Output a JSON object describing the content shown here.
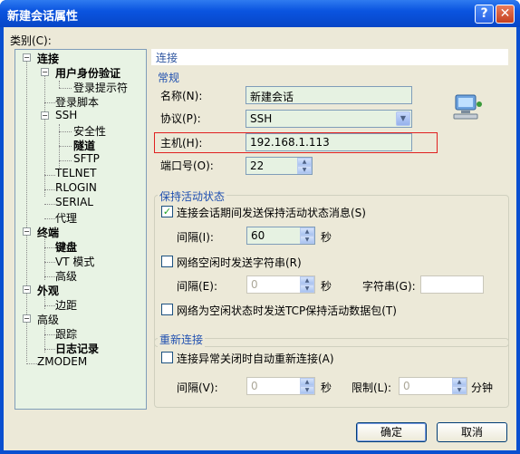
{
  "window": {
    "title": "新建会话属性",
    "help_glyph": "?",
    "close_glyph": "✕"
  },
  "category_label": "类别(C):",
  "tree": {
    "connection": "连接",
    "auth": "用户身份验证",
    "login_prompt": "登录提示符",
    "login_script": "登录脚本",
    "ssh": "SSH",
    "security": "安全性",
    "tunnel": "隧道",
    "sftp": "SFTP",
    "telnet": "TELNET",
    "rlogin": "RLOGIN",
    "serial": "SERIAL",
    "proxy": "代理",
    "terminal": "终端",
    "keyboard": "键盘",
    "vt_mode": "VT 模式",
    "advanced1": "高级",
    "appearance": "外观",
    "margin": "边距",
    "advanced2": "高级",
    "trace": "跟踪",
    "log": "日志记录",
    "zmodem": "ZMODEM"
  },
  "panel_title": "连接",
  "general": {
    "title": "常规",
    "name_label": "名称(N):",
    "name_value": "新建会话",
    "protocol_label": "协议(P):",
    "protocol_value": "SSH",
    "host_label": "主机(H):",
    "host_value": "192.168.1.113",
    "port_label": "端口号(O):",
    "port_value": "22"
  },
  "keepalive": {
    "title": "保持活动状态",
    "send_msg_label": "连接会话期间发送保持活动状态消息(S)",
    "send_msg_checked": true,
    "interval_label": "间隔(I):",
    "interval_value": "60",
    "sec": "秒",
    "send_str_label": "网络空闲时发送字符串(R)",
    "send_str_checked": false,
    "interval2_label": "间隔(E):",
    "interval2_value": "0",
    "sec2": "秒",
    "string_label": "字符串(G):",
    "tcp_label": "网络为空闲状态时发送TCP保持活动数据包(T)",
    "tcp_checked": false
  },
  "reconnect": {
    "title": "重新连接",
    "auto_label": "连接异常关闭时自动重新连接(A)",
    "auto_checked": false,
    "interval_label": "间隔(V):",
    "interval_value": "0",
    "sec": "秒",
    "limit_label": "限制(L):",
    "limit_value": "0",
    "minute": "分钟"
  },
  "buttons": {
    "ok": "确定",
    "cancel": "取消"
  },
  "icons": {
    "up": "▲",
    "down": "▼",
    "check": "✓",
    "minus": "−"
  }
}
